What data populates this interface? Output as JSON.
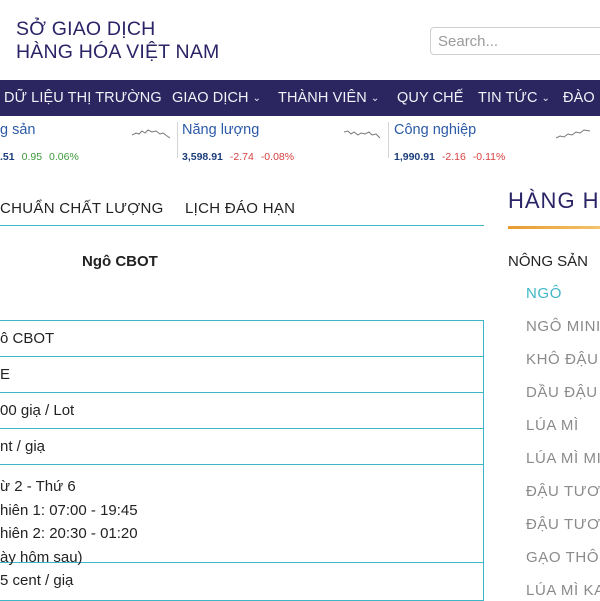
{
  "header": {
    "brand_line1": "SỞ GIAO DỊCH",
    "brand_line2": "HÀNG HÓA VIỆT NAM",
    "search_placeholder": "Search..."
  },
  "nav": {
    "items": [
      {
        "label": "DỮ LIỆU THỊ TRƯỜNG",
        "has_dropdown": false
      },
      {
        "label": "GIAO DỊCH",
        "has_dropdown": true
      },
      {
        "label": "THÀNH VIÊN",
        "has_dropdown": true
      },
      {
        "label": "QUY CHẾ",
        "has_dropdown": false
      },
      {
        "label": "TIN TỨC",
        "has_dropdown": true
      },
      {
        "label": "ĐÀO",
        "has_dropdown": false
      }
    ]
  },
  "ticker": [
    {
      "name": "g sản",
      "value": ".51",
      "change": "0.95",
      "percent": "0.06%",
      "direction": "up"
    },
    {
      "name": "Năng lượng",
      "value": "3,598.91",
      "change": "-2.74",
      "percent": "-0.08%",
      "direction": "down"
    },
    {
      "name": "Công nghiệp",
      "value": "1,990.91",
      "change": "-2.16",
      "percent": "-0.11%",
      "direction": "down"
    }
  ],
  "tabs": [
    {
      "label": "CHUẨN CHẤT LƯỢNG"
    },
    {
      "label": "LỊCH ĐÁO HẠN"
    }
  ],
  "product": {
    "title": "Ngô CBOT"
  },
  "spec_rows": [
    {
      "lines": [
        "ô CBOT"
      ]
    },
    {
      "lines": [
        "E"
      ]
    },
    {
      "lines": [
        "00 giạ / Lot"
      ]
    },
    {
      "lines": [
        "nt / giạ"
      ]
    },
    {
      "lines": [
        "ừ 2 - Thứ 6",
        "hiên 1: 07:00 - 19:45",
        "hiên 2: 20:30 - 01:20",
        "ày hôm sau)"
      ]
    },
    {
      "lines": [
        "5 cent / giạ"
      ]
    }
  ],
  "sidebar": {
    "title": "HÀNG H",
    "category": "NÔNG SẢN",
    "items": [
      {
        "label": "NGÔ",
        "active": true
      },
      {
        "label": "NGÔ MINI",
        "active": false
      },
      {
        "label": "KHÔ ĐẬU",
        "active": false
      },
      {
        "label": "DẦU ĐẬU",
        "active": false
      },
      {
        "label": "LÚA MÌ",
        "active": false
      },
      {
        "label": "LÚA MÌ MI",
        "active": false
      },
      {
        "label": "ĐẬU TƯƠI",
        "active": false
      },
      {
        "label": "ĐẬU TƯƠI",
        "active": false
      },
      {
        "label": "GẠO THÔ",
        "active": false
      },
      {
        "label": "LÚA MÌ KA",
        "active": false
      }
    ]
  },
  "colors": {
    "brand": "#2a2466",
    "nav_bg": "#2b2560",
    "accent": "#3fb6c6",
    "up": "#3c9a3c",
    "down": "#d84040"
  }
}
